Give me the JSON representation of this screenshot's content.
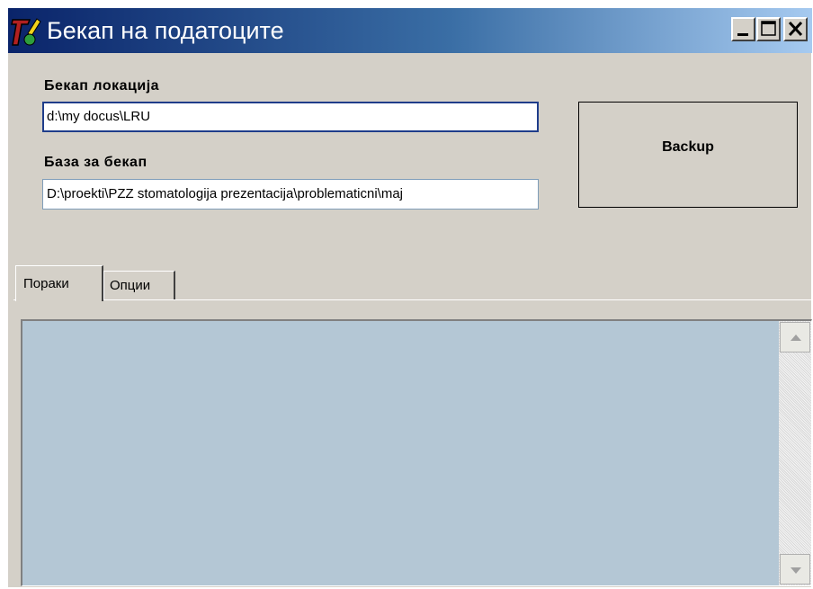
{
  "window": {
    "title": "Бекап на податоците",
    "icon": "app-logo-icon",
    "controls": [
      "minimize-icon",
      "maximize-icon",
      "close-icon"
    ]
  },
  "form": {
    "backup_location_label": "Бекап локација",
    "backup_location_value": "d:\\my docus\\LRU",
    "database_label": "База за бекап",
    "database_value": "D:\\proekti\\PZZ stomatologija prezentacija\\problematicni\\maj"
  },
  "actions": {
    "backup_label": "Backup"
  },
  "tabs": [
    {
      "label": "Пораки",
      "selected": true
    },
    {
      "label": "Опции",
      "selected": false
    }
  ],
  "messages": {
    "background_color": "#b4c7d5"
  }
}
